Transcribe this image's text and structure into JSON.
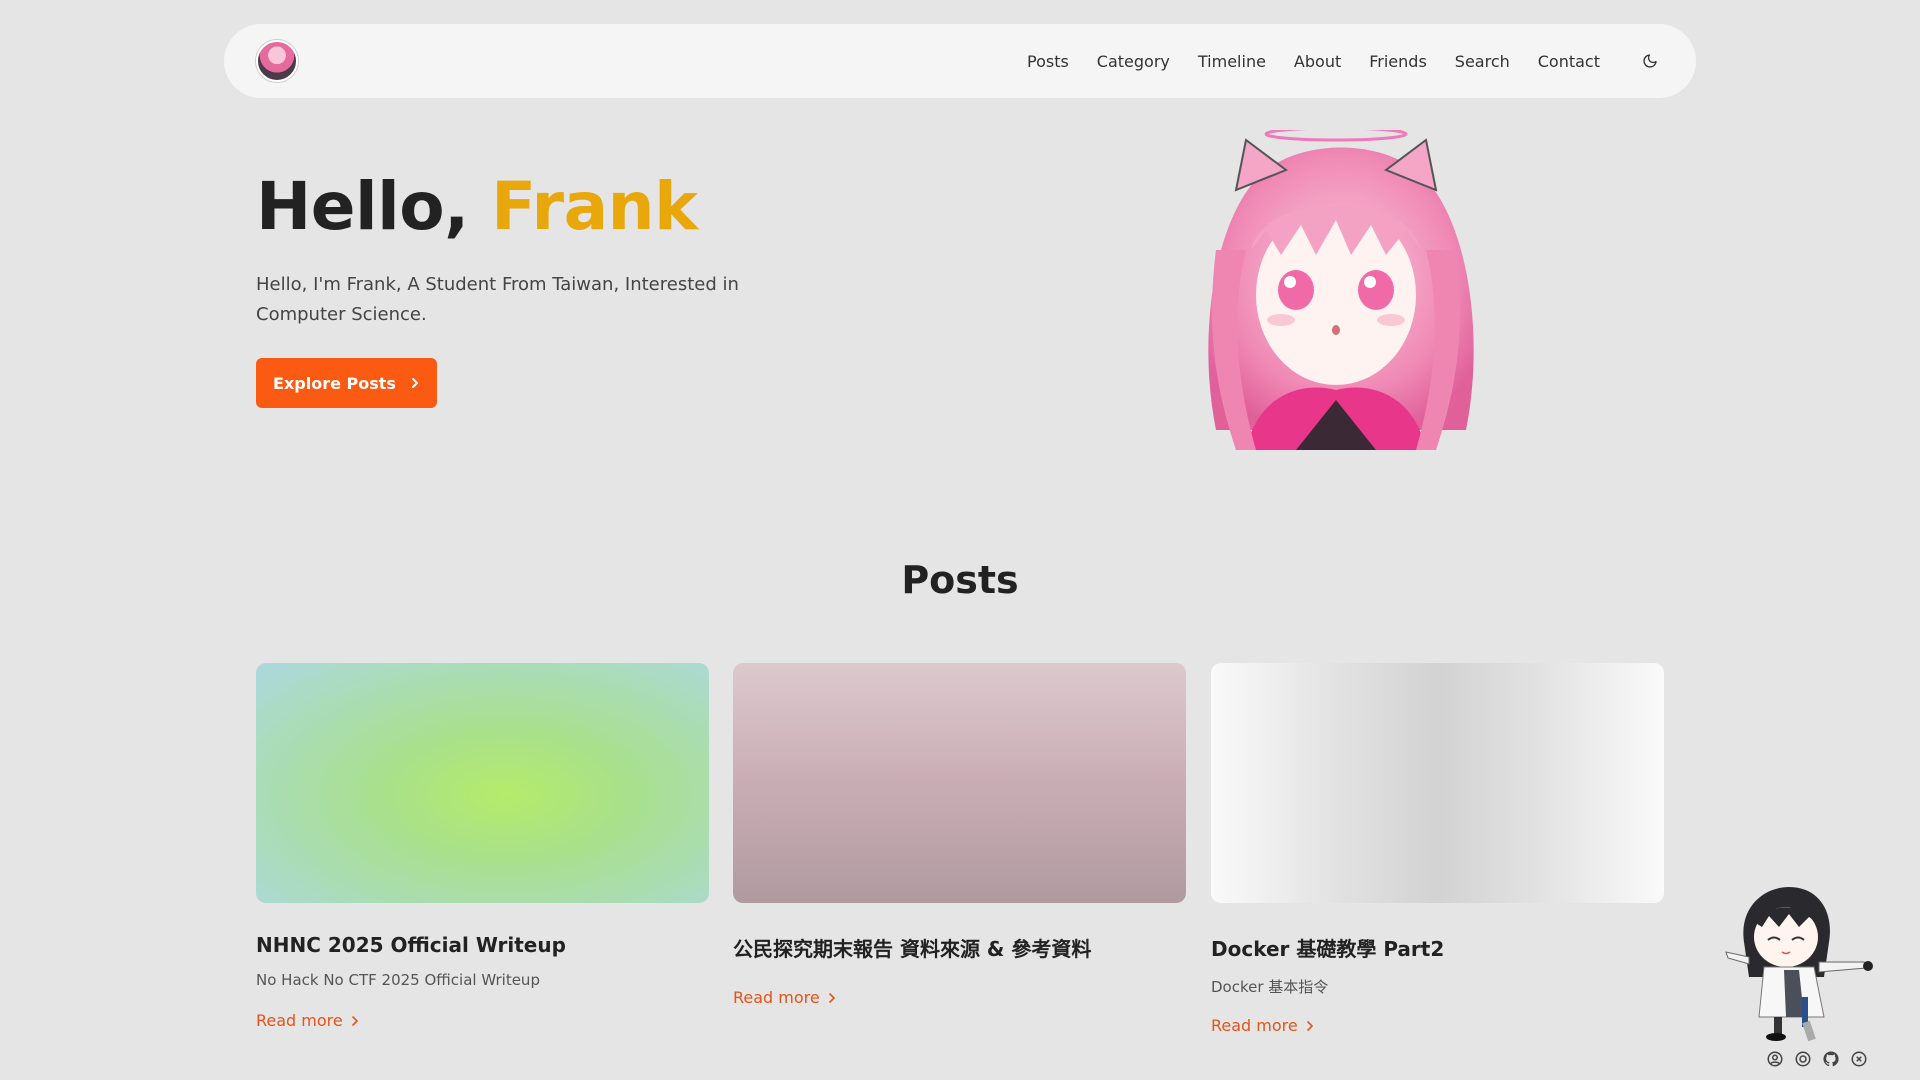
{
  "nav": {
    "links": [
      "Posts",
      "Category",
      "Timeline",
      "About",
      "Friends",
      "Search",
      "Contact"
    ]
  },
  "hero": {
    "greeting": "Hello,",
    "name": "Frank",
    "description": "Hello, I'm Frank, A Student From Taiwan, Interested in Computer Science.",
    "button_label": "Explore Posts"
  },
  "posts": {
    "heading": "Posts",
    "items": [
      {
        "title": "NHNC 2025 Official Writeup",
        "subtitle": "No Hack No CTF 2025 Official Writeup",
        "link": "Read more"
      },
      {
        "title": "公民探究期末報告 資料來源 & 參考資料",
        "subtitle": "",
        "link": "Read more"
      },
      {
        "title": "Docker 基礎教學 Part2",
        "subtitle": "Docker 基本指令",
        "link": "Read more"
      }
    ]
  },
  "colors": {
    "accent_name": "#e8a80c",
    "button": "#fb5a12",
    "link": "#e5541a",
    "background": "#e5e5e5"
  },
  "icons": {
    "theme": "moon-icon",
    "button_chevron": "chevron-right-icon",
    "mascot_toolbar": [
      "user-icon",
      "settings-icon",
      "github-icon",
      "close-icon"
    ]
  }
}
